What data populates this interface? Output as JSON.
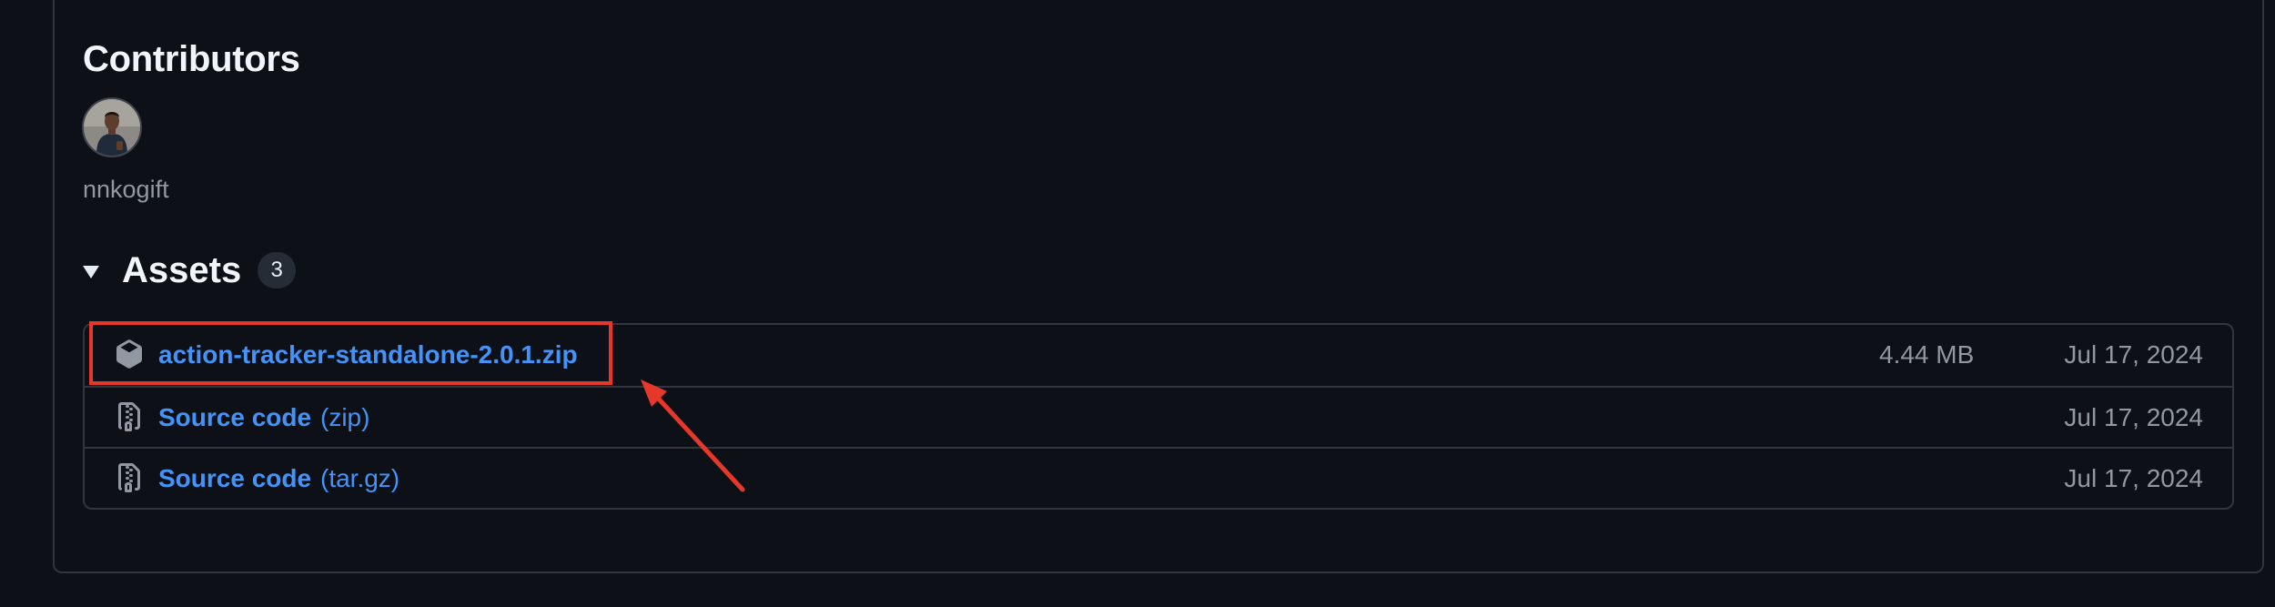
{
  "contributors": {
    "heading": "Contributors",
    "people": [
      {
        "name": "nnkogift"
      }
    ]
  },
  "assets": {
    "heading": "Assets",
    "count": "3",
    "items": [
      {
        "name": "action-tracker-standalone-2.0.1.zip",
        "suffix": "",
        "size": "4.44 MB",
        "date": "Jul 17, 2024",
        "icon": "package-icon"
      },
      {
        "name": "Source code",
        "suffix": "(zip)",
        "size": "",
        "date": "Jul 17, 2024",
        "icon": "file-zip-icon"
      },
      {
        "name": "Source code",
        "suffix": "(tar.gz)",
        "size": "",
        "date": "Jul 17, 2024",
        "icon": "file-zip-icon"
      }
    ]
  },
  "annotation": {
    "highlight_color": "#e5382a",
    "highlight_target": "action-tracker-standalone-2.0.1.zip"
  },
  "colors": {
    "background": "#0d1117",
    "link": "#4493f8",
    "muted_text": "#9198a1",
    "border": "#30363d"
  }
}
